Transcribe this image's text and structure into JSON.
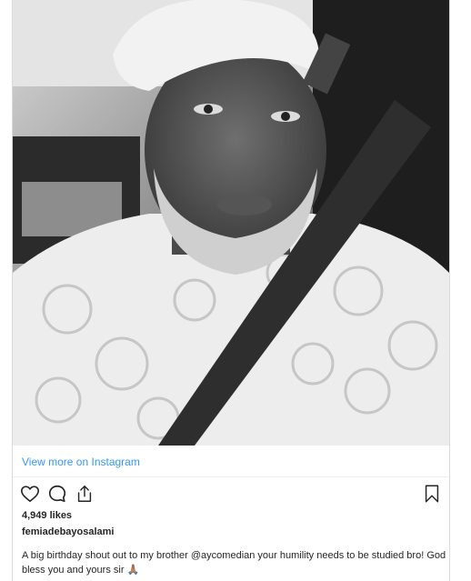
{
  "post": {
    "view_more_label": "View more on Instagram",
    "likes_text": "4,949 likes",
    "username": "femiadebayosalami",
    "caption_before": "A big birthday shout out to my brother ",
    "caption_mention": "@aycomedian",
    "caption_after": " your humility needs to be studied bro! God bless you and yours sir 🙏🏽"
  },
  "icons": {
    "like": "heart-icon",
    "comment": "comment-icon",
    "share": "share-icon",
    "save": "bookmark-icon"
  },
  "colors": {
    "link": "#3897f0",
    "text": "#262626",
    "border": "#dbdbdb"
  }
}
